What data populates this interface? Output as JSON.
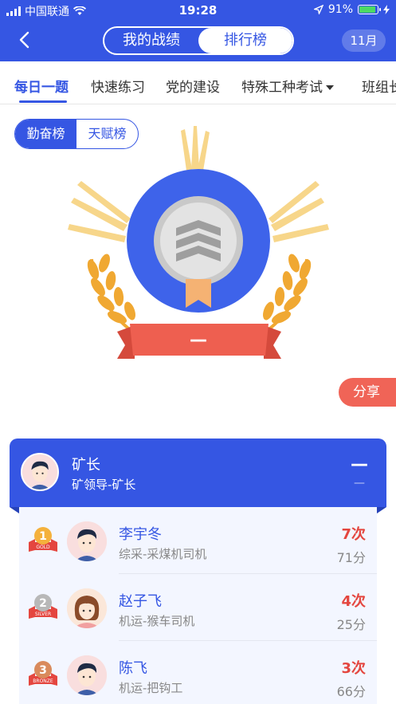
{
  "status_bar": {
    "carrier": "中国联通",
    "time": "19:28",
    "battery": "91%",
    "icons": [
      "signal-icon",
      "wifi-icon",
      "location-icon",
      "battery-icon",
      "charging-icon"
    ]
  },
  "header": {
    "back_icon": "back-arrow-icon",
    "segments": [
      {
        "label": "我的战绩",
        "selected": false
      },
      {
        "label": "排行榜",
        "selected": true
      }
    ],
    "month": "11月"
  },
  "tabs": [
    {
      "label": "每日一题",
      "active": true
    },
    {
      "label": "快速练习",
      "active": false
    },
    {
      "label": "党的建设",
      "active": false
    },
    {
      "label": "特殊工种考试",
      "active": false,
      "dropdown": true
    },
    {
      "label": "班组长",
      "active": false
    }
  ],
  "board_toggle": [
    {
      "label": "勤奋榜",
      "selected": true
    },
    {
      "label": "天赋榜",
      "selected": false
    }
  ],
  "badge": {
    "rank_label": "—"
  },
  "share_label": "分享",
  "group": {
    "name": "矿长",
    "subtitle": "矿领导-矿长",
    "rank": "—",
    "score": "—"
  },
  "ranking": [
    {
      "rank": 1,
      "medal": "GOLD",
      "name": "李宇冬",
      "dept": "综采-采煤机司机",
      "times": "7次",
      "score": "71分",
      "avatar": "male"
    },
    {
      "rank": 2,
      "medal": "SILVER",
      "name": "赵子飞",
      "dept": "机运-猴车司机",
      "times": "4次",
      "score": "25分",
      "avatar": "female"
    },
    {
      "rank": 3,
      "medal": "BRONZE",
      "name": "陈飞",
      "dept": "机运-把钩工",
      "times": "3次",
      "score": "66分",
      "avatar": "male"
    }
  ],
  "colors": {
    "primary": "#3556e3",
    "accent_red": "#f06457",
    "gold": "#f0a832",
    "text_gray": "#888888"
  }
}
